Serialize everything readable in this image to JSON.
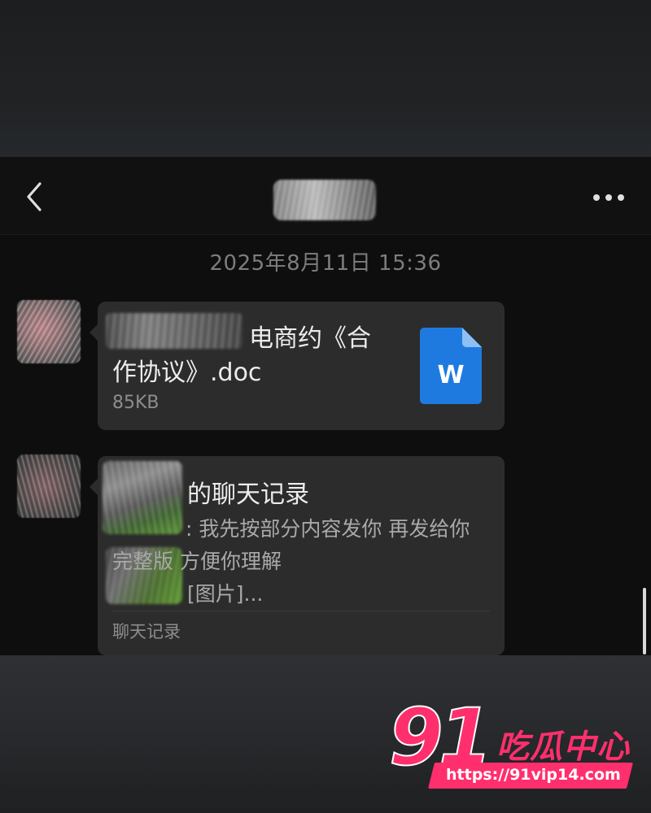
{
  "chat": {
    "timestamp": "2025年8月11日 15:36",
    "back_icon": "chevron-left-icon",
    "more_icon": "more-dots-icon"
  },
  "messages": [
    {
      "type": "file",
      "file_name_line1": "电商约《合",
      "file_name_line2": "作协议》.doc",
      "file_size": "85KB",
      "file_icon_letter": "W",
      "file_icon_color": "#1f7ae0"
    },
    {
      "type": "chat_record",
      "title": "的聊天记录",
      "lines": [
        ": 我先按部分内容发你 再发给你",
        "完整版 方便你理解",
        "[图片]..."
      ],
      "footer": "聊天记录"
    }
  ],
  "watermark": {
    "logo_text": "91",
    "title": "吃瓜中心",
    "url": "https://91vip14.com",
    "color": "#ff2f6d"
  }
}
